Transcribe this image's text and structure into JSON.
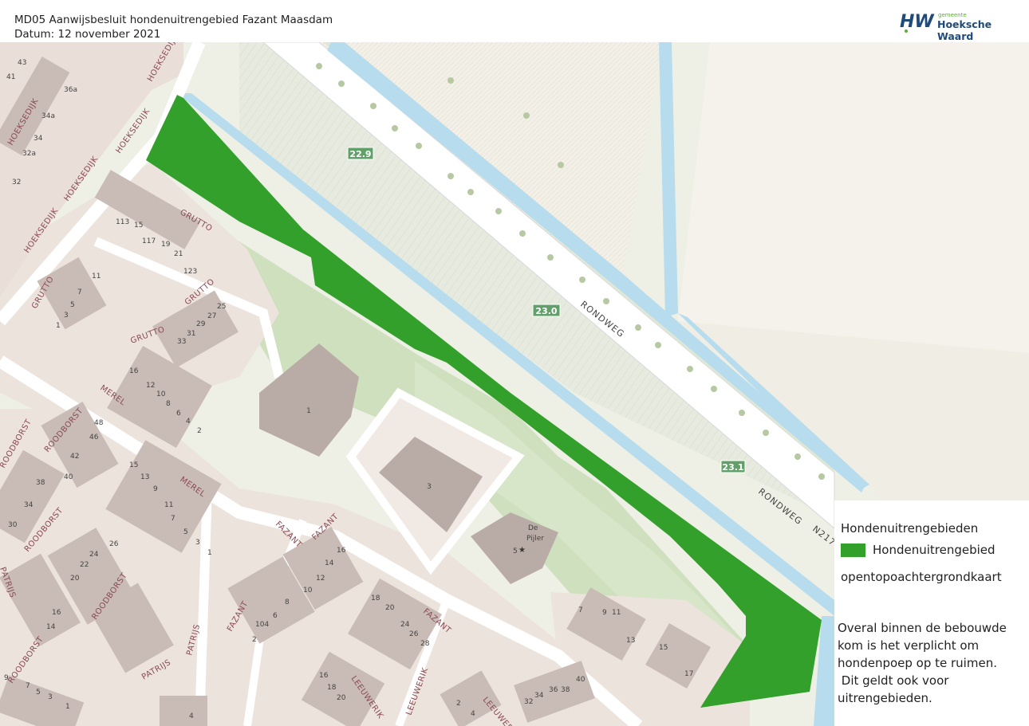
{
  "header": {
    "title": "MD05 Aanwijsbesluit hondenuitrengebied Fazant Maasdam",
    "date": "Datum: 12 november 2021"
  },
  "logo": {
    "mark": "HW",
    "small_text": "gemeente",
    "name": "Hoeksche Waard"
  },
  "legend": {
    "heading": "Hondenuitrengebieden",
    "item": "Hondenuitrengebied",
    "item_color": "#33a02c",
    "basemap": "opentopoachtergrondkaart",
    "notes": [
      "Overal binnen de bebouwde",
      "kom is het verplicht om",
      "hondenpoep op te ruimen.",
      " Dit geldt ook voor",
      "uitrengebieden."
    ]
  },
  "map": {
    "street_labels": {
      "hoeksedijk": "HOEKSEDIJK",
      "grutto": "GRUTTO",
      "merel": "MEREL",
      "roodborst": "ROODBORST",
      "fazant": "FAZANT",
      "patrijs": "PATRIJS",
      "leeuwerik": "LEEUWERIK",
      "rondweg": "RONDWEG",
      "n217": "N217"
    },
    "hectometer_markers": [
      "22.9",
      "23.0",
      "23.1"
    ],
    "building_labels": {
      "b1": "1",
      "b3": "3",
      "pijler_name_1": "De",
      "pijler_name_2": "Pijler",
      "pijler_num": "5"
    },
    "house_numbers": {
      "n43": "43",
      "n41": "41",
      "n36a": "36a",
      "n34a": "34a",
      "n34": "34",
      "n32a": "32a",
      "n32": "32",
      "n113": "113",
      "n15": "15",
      "n117": "117",
      "n19": "19",
      "n21": "21",
      "n123": "123",
      "n11": "11",
      "n7": "7",
      "n5": "5",
      "n3": "3",
      "n1": "1",
      "n25": "25",
      "n27": "27",
      "n29": "29",
      "n31": "31",
      "n33": "33",
      "n16": "16",
      "n12": "12",
      "n10": "10",
      "n8": "8",
      "n6": "6",
      "n4": "4",
      "n2": "2",
      "n48": "48",
      "n46": "46",
      "n42": "42",
      "n40": "40",
      "n38": "38",
      "n30": "30",
      "n24": "24",
      "n22": "22",
      "n20": "20",
      "n14": "14",
      "n26": "26",
      "n104": "104",
      "n18": "18",
      "n28": "28",
      "n13": "13",
      "n9": "9",
      "n17": "17",
      "n36": "36",
      "n34b": "34",
      "n32b": "32"
    }
  }
}
